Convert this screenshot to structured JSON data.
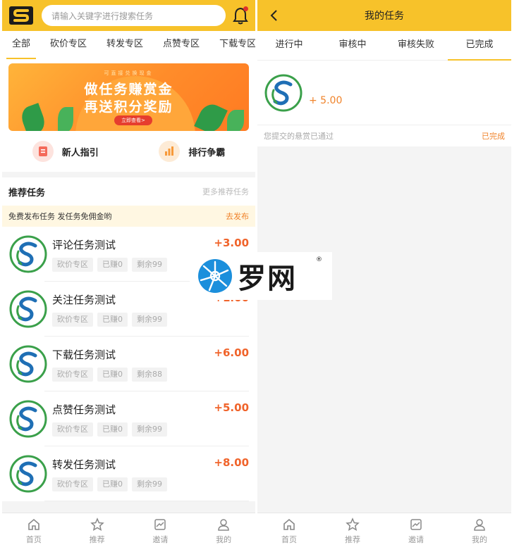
{
  "left": {
    "logo_text": "S",
    "search_placeholder": "请输入关键字进行搜索任务",
    "category_tabs": [
      "全部",
      "砍价专区",
      "转发专区",
      "点赞专区",
      "下载专区"
    ],
    "banner": {
      "tag": "可直接兑换现金",
      "line1": "做任务赚赏金",
      "line2": "再送积分奖励",
      "cta": "立即查看>"
    },
    "quick_links": [
      {
        "label": "新人指引",
        "icon": "guide-icon",
        "color": "#f46a5a"
      },
      {
        "label": "排行争霸",
        "icon": "ranking-icon",
        "color": "#f79a3a"
      }
    ],
    "section_title": "推荐任务",
    "section_more": "更多推荐任务",
    "notice_text": "免费发布任务 发任务免佣金哟",
    "notice_action": "去发布",
    "tasks": [
      {
        "name": "评论任务测试",
        "reward": "+3.00",
        "chips": [
          "砍价专区",
          "已赚0",
          "剩余99"
        ]
      },
      {
        "name": "关注任务测试",
        "reward": "+1.00",
        "chips": [
          "砍价专区",
          "已赚0",
          "剩余99"
        ]
      },
      {
        "name": "下载任务测试",
        "reward": "+6.00",
        "chips": [
          "砍价专区",
          "已赚0",
          "剩余88"
        ]
      },
      {
        "name": "点赞任务测试",
        "reward": "+5.00",
        "chips": [
          "砍价专区",
          "已赚0",
          "剩余99"
        ]
      },
      {
        "name": "转发任务测试",
        "reward": "+8.00",
        "chips": [
          "砍价专区",
          "已赚0",
          "剩余99"
        ]
      }
    ]
  },
  "right": {
    "title": "我的任务",
    "status_tabs": [
      "进行中",
      "审核中",
      "审核失败",
      "已完成"
    ],
    "my_task": {
      "amount": "+ 5.00",
      "message": "您提交的悬赏已通过",
      "status": "已完成"
    }
  },
  "tabbar": [
    {
      "label": "首页",
      "icon": "home-icon"
    },
    {
      "label": "推荐",
      "icon": "star-icon"
    },
    {
      "label": "邀请",
      "icon": "invite-icon"
    },
    {
      "label": "我的",
      "icon": "user-icon"
    }
  ],
  "watermark": {
    "text": "罗网",
    "mark": "®"
  },
  "colors": {
    "accent": "#f7c22a",
    "reward": "#f0632a",
    "status": "#f0832a"
  }
}
